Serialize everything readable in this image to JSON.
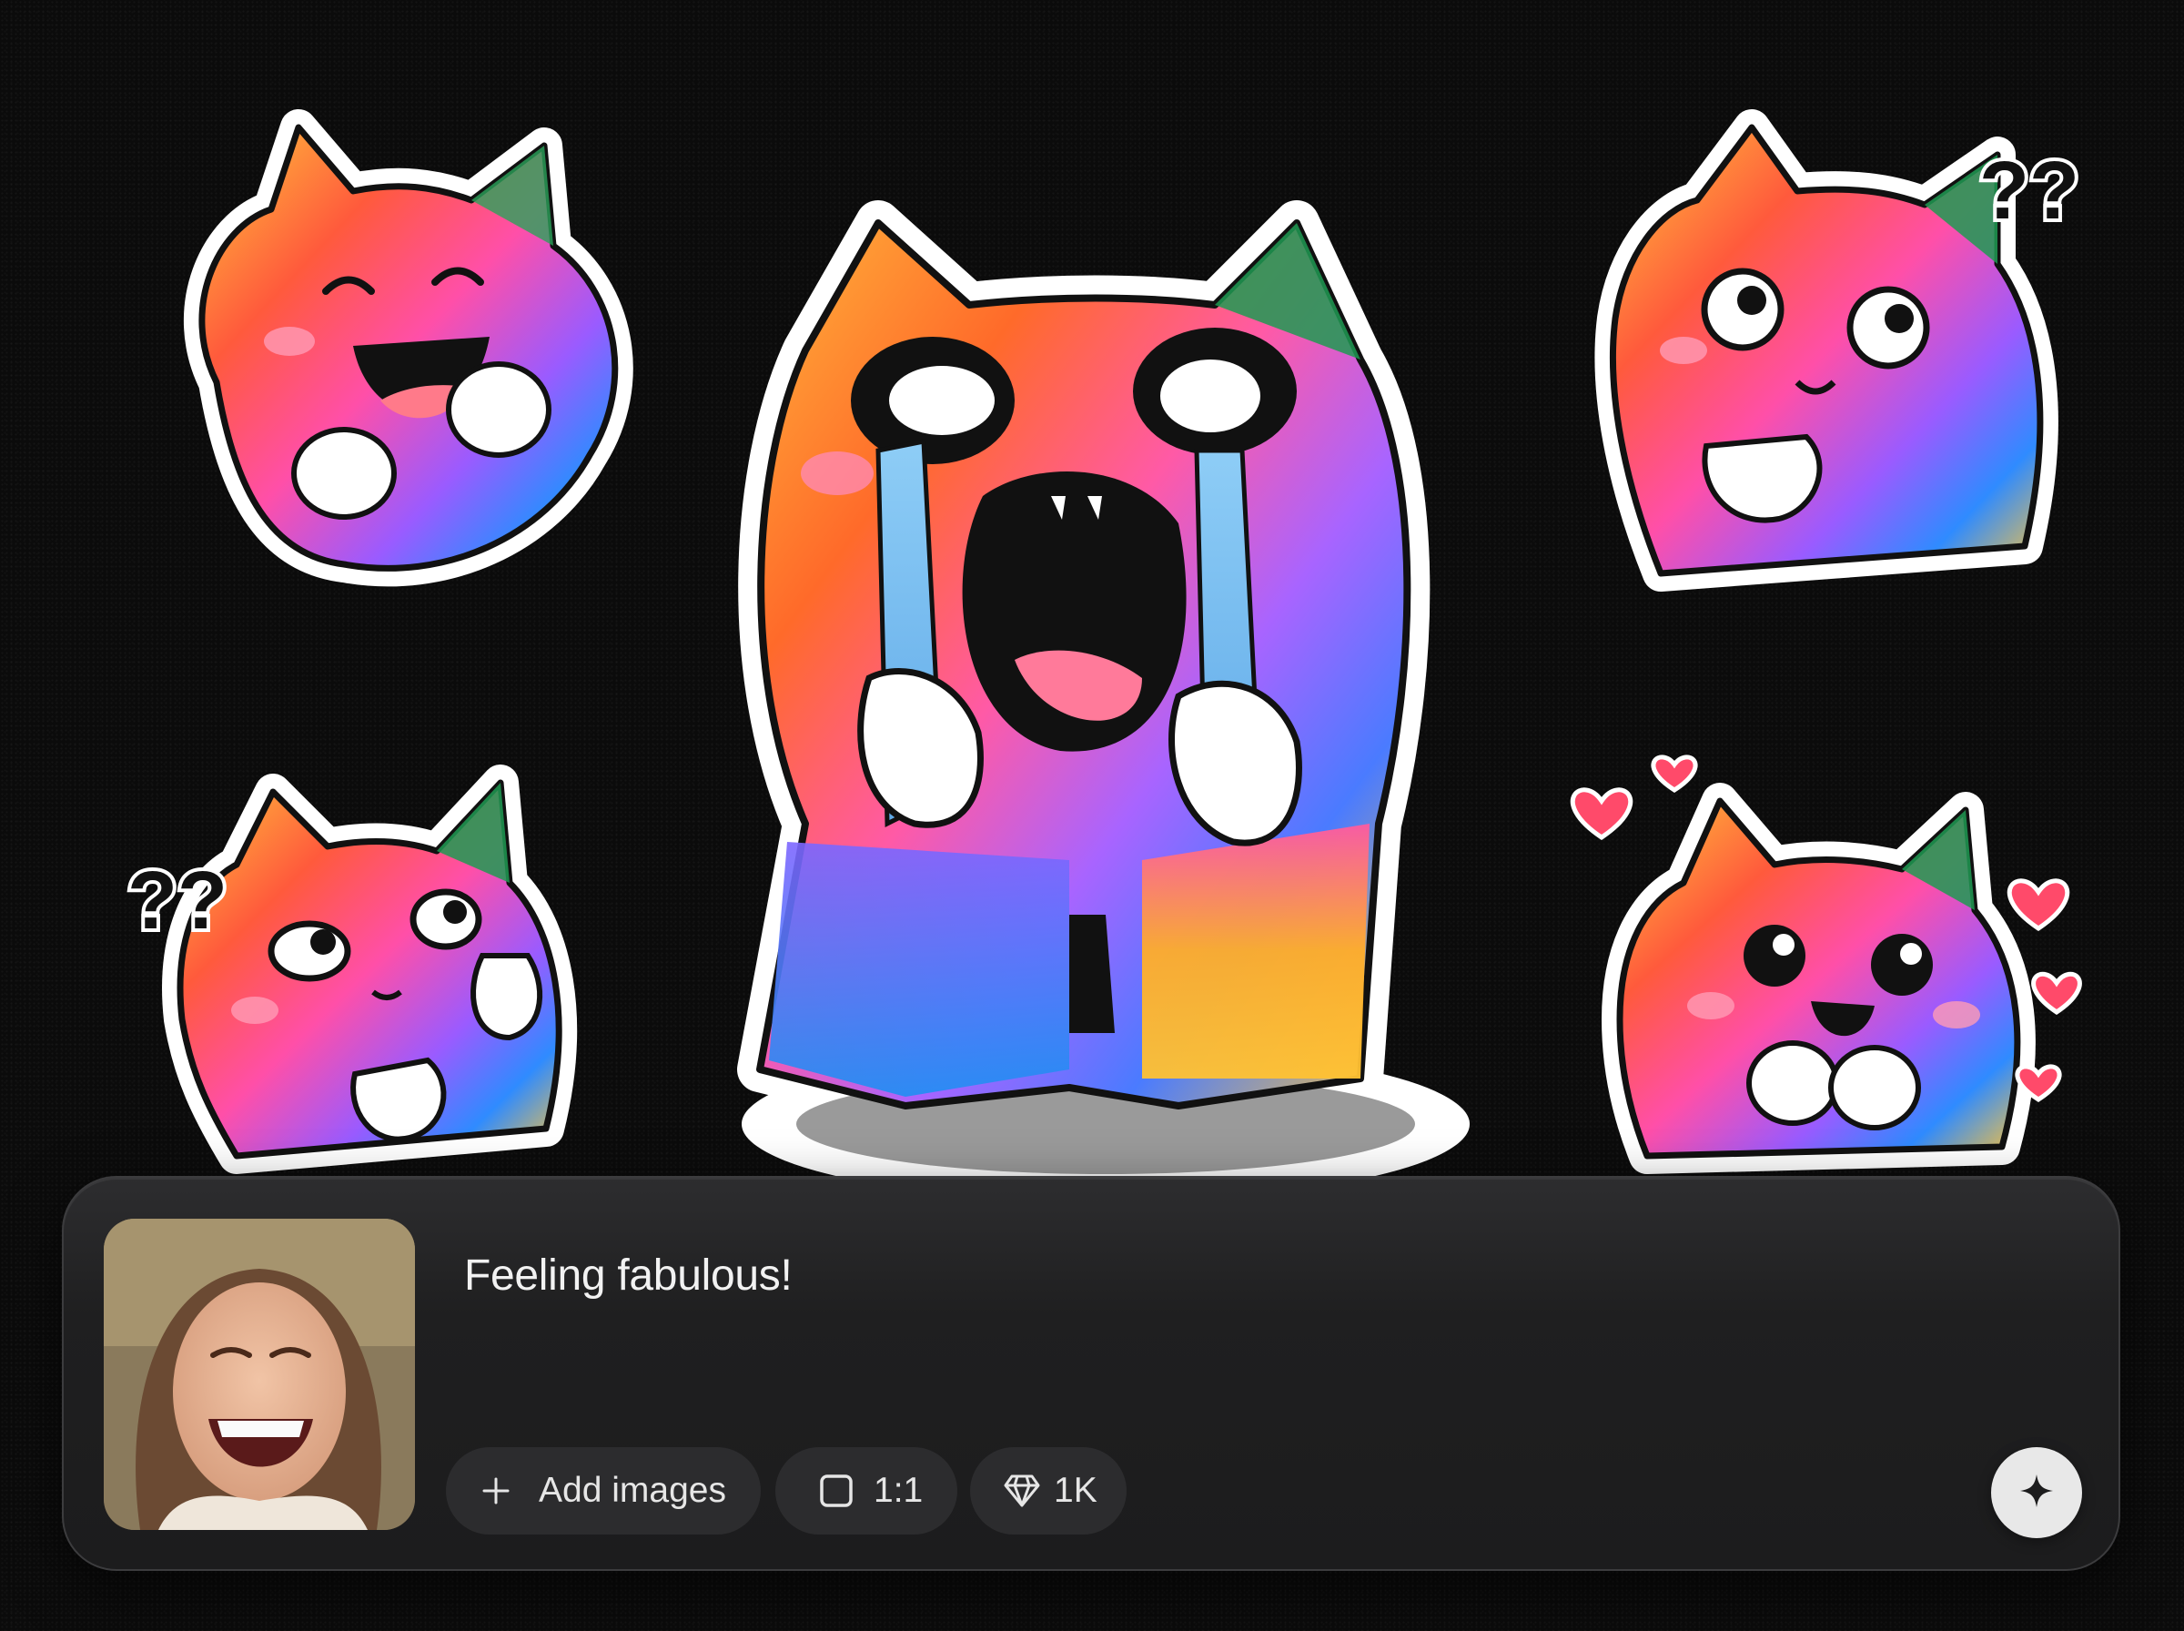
{
  "prompt": {
    "text": "Feeling fabulous!"
  },
  "toolbar": {
    "add_images_label": "Add images",
    "aspect_ratio_label": "1:1",
    "quality_label": "1K"
  },
  "icons": {
    "add": "plus-icon",
    "aspect_ratio": "square-icon",
    "quality": "diamond-icon",
    "generate": "sparkle-icon"
  },
  "stickers": {
    "left_bottom_marks": "??",
    "right_top_marks": "??"
  },
  "colors": {
    "background": "#0b0b0b",
    "panel": "#1f1f20",
    "chip": "#2c2c2e",
    "text": "#f2f2f2",
    "generate_button": "#e8e8e8"
  }
}
